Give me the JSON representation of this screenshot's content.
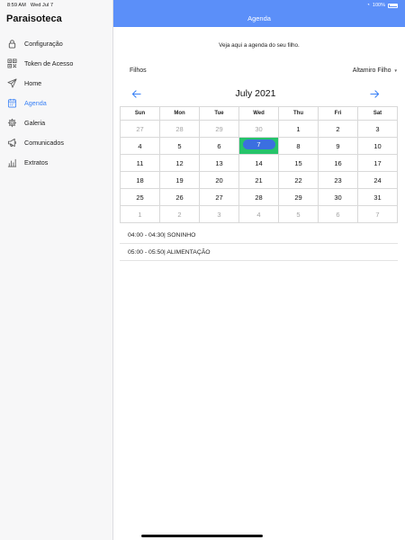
{
  "status": {
    "time": "8:59 AM",
    "date": "Wed Jul 7",
    "battery": "100%"
  },
  "sidebar": {
    "title": "Paraisoteca",
    "items": [
      {
        "label": "Configuração",
        "icon": "lock-icon"
      },
      {
        "label": "Token de Acesso",
        "icon": "qr-code-icon"
      },
      {
        "label": "Home",
        "icon": "send-icon"
      },
      {
        "label": "Agenda",
        "icon": "calendar-icon",
        "active": true
      },
      {
        "label": "Galeria",
        "icon": "gear-icon"
      },
      {
        "label": "Comunicados",
        "icon": "megaphone-icon"
      },
      {
        "label": "Extratos",
        "icon": "bar-chart-icon"
      }
    ]
  },
  "header": {
    "title": "Agenda"
  },
  "main": {
    "intro": "Veja aqui a agenda do seu filho.",
    "filhos_label": "Filhos",
    "selected_child": "Altamiro Filho"
  },
  "calendar": {
    "month": "July 2021",
    "weekdays": [
      "Sun",
      "Mon",
      "Tue",
      "Wed",
      "Thu",
      "Fri",
      "Sat"
    ],
    "weeks": [
      [
        {
          "d": "27",
          "m": true
        },
        {
          "d": "28",
          "m": true
        },
        {
          "d": "29",
          "m": true
        },
        {
          "d": "30",
          "m": true
        },
        {
          "d": "1"
        },
        {
          "d": "2"
        },
        {
          "d": "3"
        }
      ],
      [
        {
          "d": "4"
        },
        {
          "d": "5"
        },
        {
          "d": "6"
        },
        {
          "d": "7",
          "sel": true
        },
        {
          "d": "8"
        },
        {
          "d": "9"
        },
        {
          "d": "10"
        }
      ],
      [
        {
          "d": "11"
        },
        {
          "d": "12"
        },
        {
          "d": "13"
        },
        {
          "d": "14"
        },
        {
          "d": "15"
        },
        {
          "d": "16"
        },
        {
          "d": "17"
        }
      ],
      [
        {
          "d": "18"
        },
        {
          "d": "19"
        },
        {
          "d": "20"
        },
        {
          "d": "21"
        },
        {
          "d": "22"
        },
        {
          "d": "23"
        },
        {
          "d": "24"
        }
      ],
      [
        {
          "d": "25"
        },
        {
          "d": "26"
        },
        {
          "d": "27"
        },
        {
          "d": "28"
        },
        {
          "d": "29"
        },
        {
          "d": "30"
        },
        {
          "d": "31"
        }
      ],
      [
        {
          "d": "1",
          "m": true
        },
        {
          "d": "2",
          "m": true
        },
        {
          "d": "3",
          "m": true
        },
        {
          "d": "4",
          "m": true
        },
        {
          "d": "5",
          "m": true
        },
        {
          "d": "6",
          "m": true
        },
        {
          "d": "7",
          "m": true
        }
      ]
    ]
  },
  "events": [
    {
      "text": "04:00 - 04:30| SONINHO"
    },
    {
      "text": "05:00 - 05:50| ALIMENTAÇÃO"
    }
  ],
  "colors": {
    "accent": "#3b82f6",
    "topbar": "#5b8ff9",
    "selected_cell": "#26c46a",
    "selected_pill": "#3b6fe0"
  }
}
